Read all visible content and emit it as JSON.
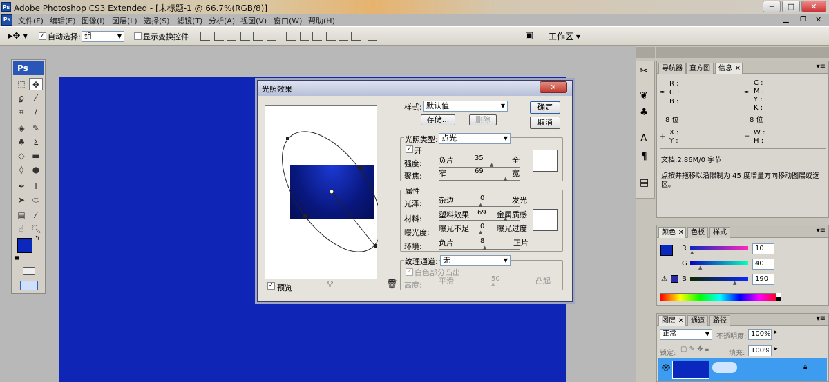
{
  "app": {
    "title": "Adobe Photoshop CS3 Extended - [未标题-1 @ 66.7%(RGB/8)]",
    "icon": "Ps"
  },
  "menu": [
    "文件(F)",
    "编辑(E)",
    "图像(I)",
    "图层(L)",
    "选择(S)",
    "滤镜(T)",
    "分析(A)",
    "视图(V)",
    "窗口(W)",
    "帮助(H)"
  ],
  "options": {
    "auto_select_label": "自动选择:",
    "auto_select_value": "组",
    "show_transform_label": "显示变换控件",
    "workspace_label": "工作区"
  },
  "toolbox": {
    "logo": "Ps"
  },
  "canvas": {
    "color": "#0f25b6"
  },
  "dialog": {
    "title": "光照效果",
    "style_label": "样式:",
    "style_value": "默认值",
    "save_label": "存储...",
    "delete_label": "删除",
    "ok_label": "确定",
    "cancel_label": "取消",
    "light_type_label": "光照类型:",
    "light_type_value": "点光",
    "on_label": "开",
    "intensity": {
      "label": "强度:",
      "left": "负片",
      "value": "35",
      "right": "全"
    },
    "focus": {
      "label": "聚焦:",
      "left": "窄",
      "value": "69",
      "right": "宽"
    },
    "properties_label": "属性",
    "gloss": {
      "label": "光泽:",
      "left": "杂边",
      "value": "0",
      "right": "发光"
    },
    "material": {
      "label": "材料:",
      "left": "塑料效果",
      "value": "69",
      "right": "金属质感"
    },
    "exposure": {
      "label": "曝光度:",
      "left": "曝光不足",
      "value": "0",
      "right": "曝光过度"
    },
    "ambience": {
      "label": "环境:",
      "left": "负片",
      "value": "8",
      "right": "正片"
    },
    "texture_label": "纹理通道:",
    "texture_value": "无",
    "white_high_label": "白色部分凸出",
    "height": {
      "label": "高度:",
      "left": "平滑",
      "value": "50",
      "right": "凸起"
    },
    "preview_label": "预览"
  },
  "nav_panel": {
    "tabs": [
      "导航器",
      "直方图",
      "信息"
    ],
    "info": {
      "r": "R :",
      "g": "G :",
      "b": "B :",
      "bit_left": "8 位",
      "c": "C :",
      "m": "M :",
      "y": "Y :",
      "k": "K :",
      "bit_right": "8 位",
      "x": "X :",
      "yy": "Y :",
      "w": "W :",
      "h": "H :"
    },
    "doc_size": "文档:2.86M/0 字节",
    "hint": "点按并拖移以沿限制为 45 度增量方向移动图层或选区。"
  },
  "color_panel": {
    "tabs": [
      "颜色",
      "色板",
      "样式"
    ],
    "r": {
      "label": "R",
      "value": "10"
    },
    "g": {
      "label": "G",
      "value": "40"
    },
    "b": {
      "label": "B",
      "value": "190"
    },
    "fg_color": "#0a28be"
  },
  "layers_panel": {
    "tabs": [
      "图层",
      "通道",
      "路径"
    ],
    "blend_mode": "正常",
    "opacity_label": "不透明度:",
    "opacity_value": "100%",
    "lock_label": "锁定:",
    "fill_label": "填充:",
    "fill_value": "100%"
  }
}
